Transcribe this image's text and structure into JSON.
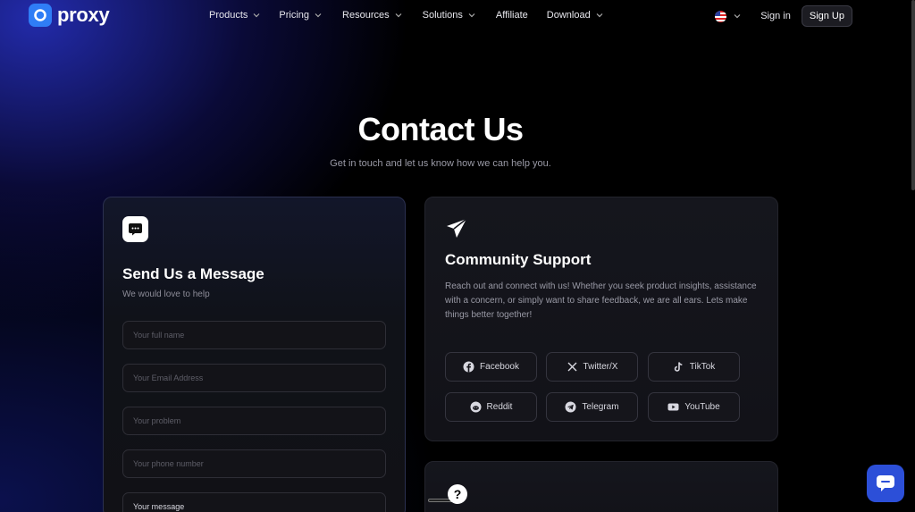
{
  "brand": {
    "name": "proxy"
  },
  "nav": {
    "items": [
      {
        "label": "Products",
        "dropdown": true
      },
      {
        "label": "Pricing",
        "dropdown": true
      },
      {
        "label": "Resources",
        "dropdown": true
      },
      {
        "label": "Solutions",
        "dropdown": true
      },
      {
        "label": "Affiliate",
        "dropdown": false
      },
      {
        "label": "Download",
        "dropdown": true
      }
    ],
    "signin": "Sign in",
    "signup": "Sign Up",
    "locale_icon": "us-flag-icon"
  },
  "hero": {
    "title": "Contact Us",
    "subtitle": "Get in touch and let us know how we can help you."
  },
  "message_card": {
    "title": "Send Us a Message",
    "subtitle": "We would love to help",
    "fields": {
      "full_name": "Your full name",
      "email": "Your Email Address",
      "problem": "Your problem",
      "phone": "Your phone number",
      "message": "Your message"
    }
  },
  "community_card": {
    "title": "Community Support",
    "text": "Reach out and connect with us! Whether you seek product insights, assistance with a concern, or simply want to share feedback, we are all ears. Lets make things better together!",
    "socials": [
      {
        "label": "Facebook",
        "icon": "facebook-icon"
      },
      {
        "label": "Twitter/X",
        "icon": "x-icon"
      },
      {
        "label": "TikTok",
        "icon": "tiktok-icon"
      },
      {
        "label": "Reddit",
        "icon": "reddit-icon"
      },
      {
        "label": "Telegram",
        "icon": "telegram-icon"
      },
      {
        "label": "YouTube",
        "icon": "youtube-icon"
      }
    ]
  },
  "colors": {
    "accent": "#2f7df6",
    "chat_button": "#2c4fd8",
    "background": "#000000"
  }
}
